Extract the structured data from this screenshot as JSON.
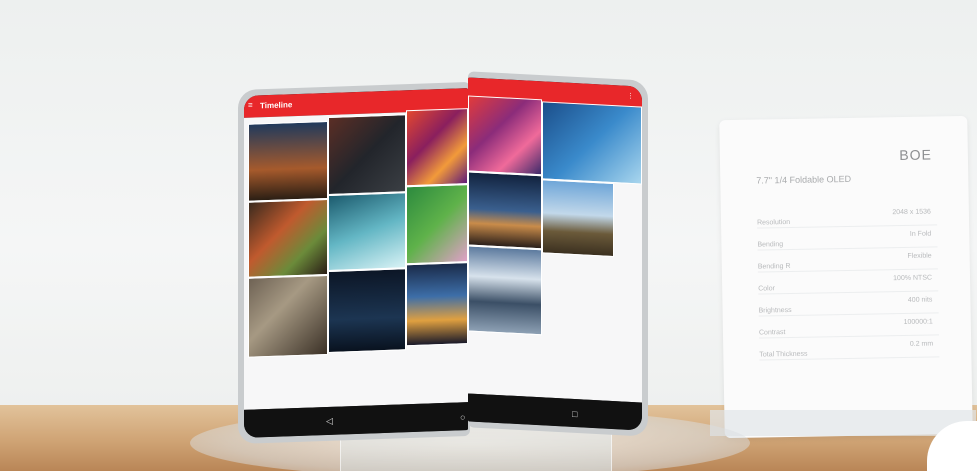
{
  "app": {
    "title": "Timeline"
  },
  "placard": {
    "brand": "BOE",
    "title": "7.7\" 1/4 Foldable OLED",
    "rows": [
      {
        "label": "Resolution",
        "value": "2048 x 1536"
      },
      {
        "label": "Bending",
        "value": "In Fold"
      },
      {
        "label": "Bending R",
        "value": "Flexible"
      },
      {
        "label": "Color",
        "value": "100% NTSC"
      },
      {
        "label": "Brightness",
        "value": "400 nits"
      },
      {
        "label": "Contrast",
        "value": "100000:1"
      },
      {
        "label": "Total Thickness",
        "value": "0.2 mm"
      }
    ]
  },
  "nav": {
    "back": "◁",
    "home": "○",
    "recent": "□"
  },
  "colors": {
    "appbar": "#e8272a",
    "bezel": "#1a1a1c"
  }
}
